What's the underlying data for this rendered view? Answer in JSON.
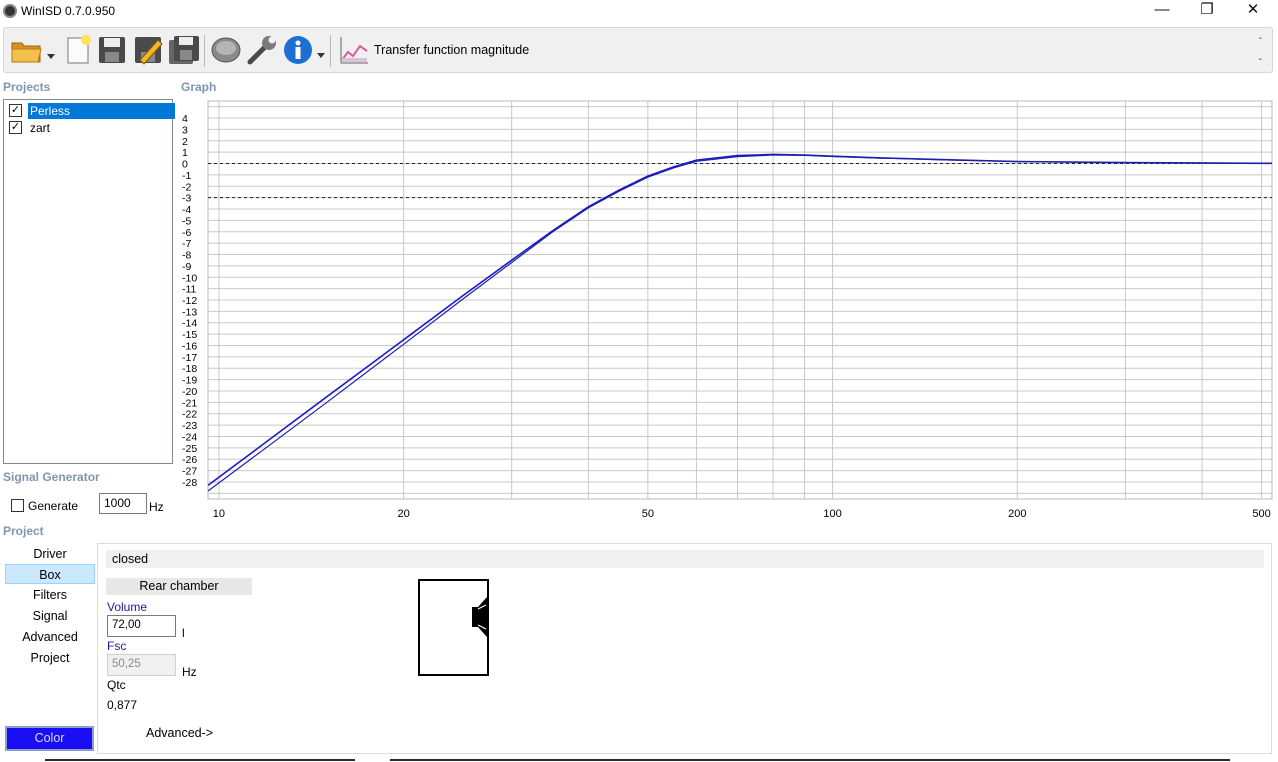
{
  "window": {
    "title": "WinISD 0.7.0.950",
    "minimize_glyph": "—",
    "restore_glyph": "❐",
    "close_glyph": "✕"
  },
  "toolbar": {
    "icons": [
      "open-folder-icon",
      "dropdown-arrow-icon",
      "new-document-icon",
      "save-icon",
      "save-edit-icon",
      "save-all-icon",
      "driver-icon",
      "wrench-icon",
      "info-icon",
      "dropdown-arrow-icon",
      "graph-type-icon"
    ],
    "graph_type_label": "Transfer function magnitude",
    "dash_top": "-",
    "dash_bottom": "-"
  },
  "projects": {
    "label": "Projects",
    "items": [
      {
        "name": "Perless",
        "checked": true,
        "selected": true
      },
      {
        "name": "zart",
        "checked": true,
        "selected": false
      }
    ]
  },
  "graph": {
    "label": "Graph"
  },
  "signal_generator": {
    "label": "Signal Generator",
    "generate_label": "Generate",
    "generate_checked": false,
    "frequency_value": "1000",
    "frequency_unit": "Hz"
  },
  "project_panel": {
    "label": "Project",
    "nav": [
      "Driver",
      "Box",
      "Filters",
      "Signal",
      "Advanced",
      "Project"
    ],
    "active_nav": "Box",
    "color_button": "Color",
    "color_value": "#1a0ef5",
    "box_type": "closed",
    "chamber_tab": "Rear chamber",
    "volume_label": "Volume",
    "volume_value": "72,00",
    "volume_unit": "l",
    "fsc_label": "Fsc",
    "fsc_value": "50,25",
    "fsc_unit": "Hz",
    "qtc_label": "Qtc",
    "qtc_value": "0,877",
    "advanced_link": "Advanced->"
  },
  "chart_data": {
    "type": "line",
    "title": "",
    "xlabel": "",
    "ylabel": "",
    "x_scale": "log",
    "xlim": [
      9.6,
      520
    ],
    "ylim": [
      -29.5,
      5.5
    ],
    "x_tick_labels": [
      "10",
      "20",
      "50",
      "100",
      "200",
      "500"
    ],
    "x_ticks": [
      10,
      20,
      50,
      100,
      200,
      500
    ],
    "y_ticks": [
      4,
      3,
      2,
      1,
      0,
      -1,
      -2,
      -3,
      -4,
      -5,
      -6,
      -7,
      -8,
      -9,
      -10,
      -11,
      -12,
      -13,
      -14,
      -15,
      -16,
      -17,
      -18,
      -19,
      -20,
      -21,
      -22,
      -23,
      -24,
      -25,
      -26,
      -27,
      -28
    ],
    "reference_lines": [
      0,
      -3
    ],
    "grid": true,
    "series_colors": [
      "#1a1ad0",
      "#2020a0"
    ],
    "series": [
      {
        "name": "Perless",
        "x": [
          9.6,
          12,
          15,
          20,
          25,
          30,
          35,
          40,
          45,
          50,
          55,
          60,
          70,
          80,
          90,
          100,
          120,
          150,
          200,
          300,
          500,
          520
        ],
        "y": [
          -28.3,
          -24.4,
          -20.5,
          -15.5,
          -11.6,
          -8.5,
          -5.9,
          -3.8,
          -2.3,
          -1.1,
          -0.3,
          0.3,
          0.7,
          0.8,
          0.75,
          0.65,
          0.5,
          0.35,
          0.18,
          0.08,
          0.02,
          0.02
        ]
      },
      {
        "name": "zart",
        "x": [
          9.6,
          12,
          15,
          20,
          25,
          30,
          35,
          40,
          45,
          50,
          55,
          60,
          70,
          80,
          90,
          100,
          120,
          150,
          200,
          300,
          500,
          520
        ],
        "y": [
          -28.8,
          -24.9,
          -21.0,
          -15.9,
          -11.9,
          -8.7,
          -6.0,
          -3.9,
          -2.4,
          -1.2,
          -0.4,
          0.2,
          0.6,
          0.75,
          0.72,
          0.62,
          0.48,
          0.33,
          0.17,
          0.07,
          0.02,
          0.02
        ]
      }
    ]
  }
}
